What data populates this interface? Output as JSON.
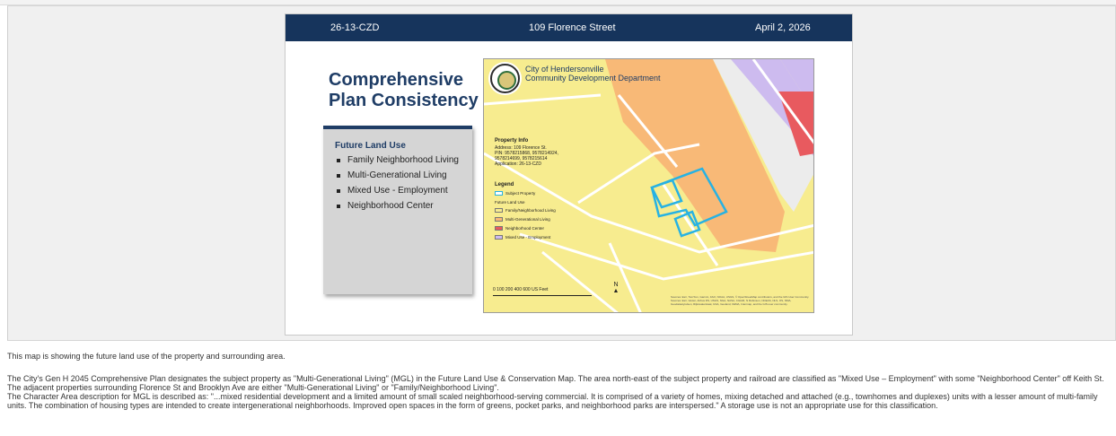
{
  "slide": {
    "header": {
      "case_number": "26-13-CZD",
      "address": "109 Florence Street",
      "date": "April 2, 2026"
    },
    "title_line1": "Comprehensive",
    "title_line2": "Plan Consistency",
    "panel": {
      "title": "Future Land Use",
      "items": [
        "Family Neighborhood Living",
        "Multi-Generational Living",
        "Mixed Use - Employment",
        "Neighborhood Center"
      ]
    },
    "map": {
      "org_line1": "City of Hendersonville",
      "org_line2": "Community Development Department",
      "property_info": {
        "heading": "Property Info",
        "address": "Address: 109 Florence St.",
        "pin": "PIN: 9578215868, 9578214924, 9578214699, 9578215614",
        "application": "Application: 26-13-CZD"
      },
      "legend": {
        "heading": "Legend",
        "subject": "Subject Property",
        "flu_heading": "Future Land Use",
        "items": [
          {
            "label": "Family/Neighborhood Living",
            "color": "#f7ec8f"
          },
          {
            "label": "Multi-Generational Living",
            "color": "#f8b977"
          },
          {
            "label": "Neighborhood Center",
            "color": "#e85a5f"
          },
          {
            "label": "Mixed Use - Employment",
            "color": "#cdbbef"
          }
        ],
        "subject_color": "#27b2e3"
      },
      "scale_labels": "0 100 200 400 600 US Feet",
      "north_label": "N",
      "credits": "Sources: Esri, TomTom, Garmin, FAO, NOAA, USGS, © OpenStreetMap contributors, and the GIS User Community. Sources: Esri, Vantor, Airbus DS, USGS, NGA, NASA, CGIAR, N Robinson, NCEAS, NLS, OS, NMA, Geodatastyrelsen, Rijkswaterstaat, GSA, Geoland, FEMA, Intermap, and the GIS user community."
    }
  },
  "caption": "This map is showing the future land use of the property and surrounding area.",
  "description": {
    "para1": "The City's Gen H 2045 Comprehensive Plan designates the subject property as \"Multi-Generational Living\" (MGL) in the Future Land Use & Conservation Map. The area north-east of the subject property and railroad are classified as \"Mixed Use – Employment\" with some \"Neighborhood Center\" off Keith St. The adjacent properties surrounding Florence St and Brooklyn Ave are either \"Multi-Generational Living\" or \"Family/Neighborhood Living\".",
    "para2": "The Character Area description for MGL is described as: \"...mixed residential development and a limited amount of small scaled neighborhood-serving commercial. It is comprised of a variety of homes, mixing detached and attached (e.g., townhomes and duplexes) units with a lesser amount of multi-family units. The combination of housing types are intended to create intergenerational neighborhoods. Improved open spaces in the form of greens, pocket parks, and neighborhood parks are interspersed.\" A storage use is not an appropriate use for this classification."
  }
}
